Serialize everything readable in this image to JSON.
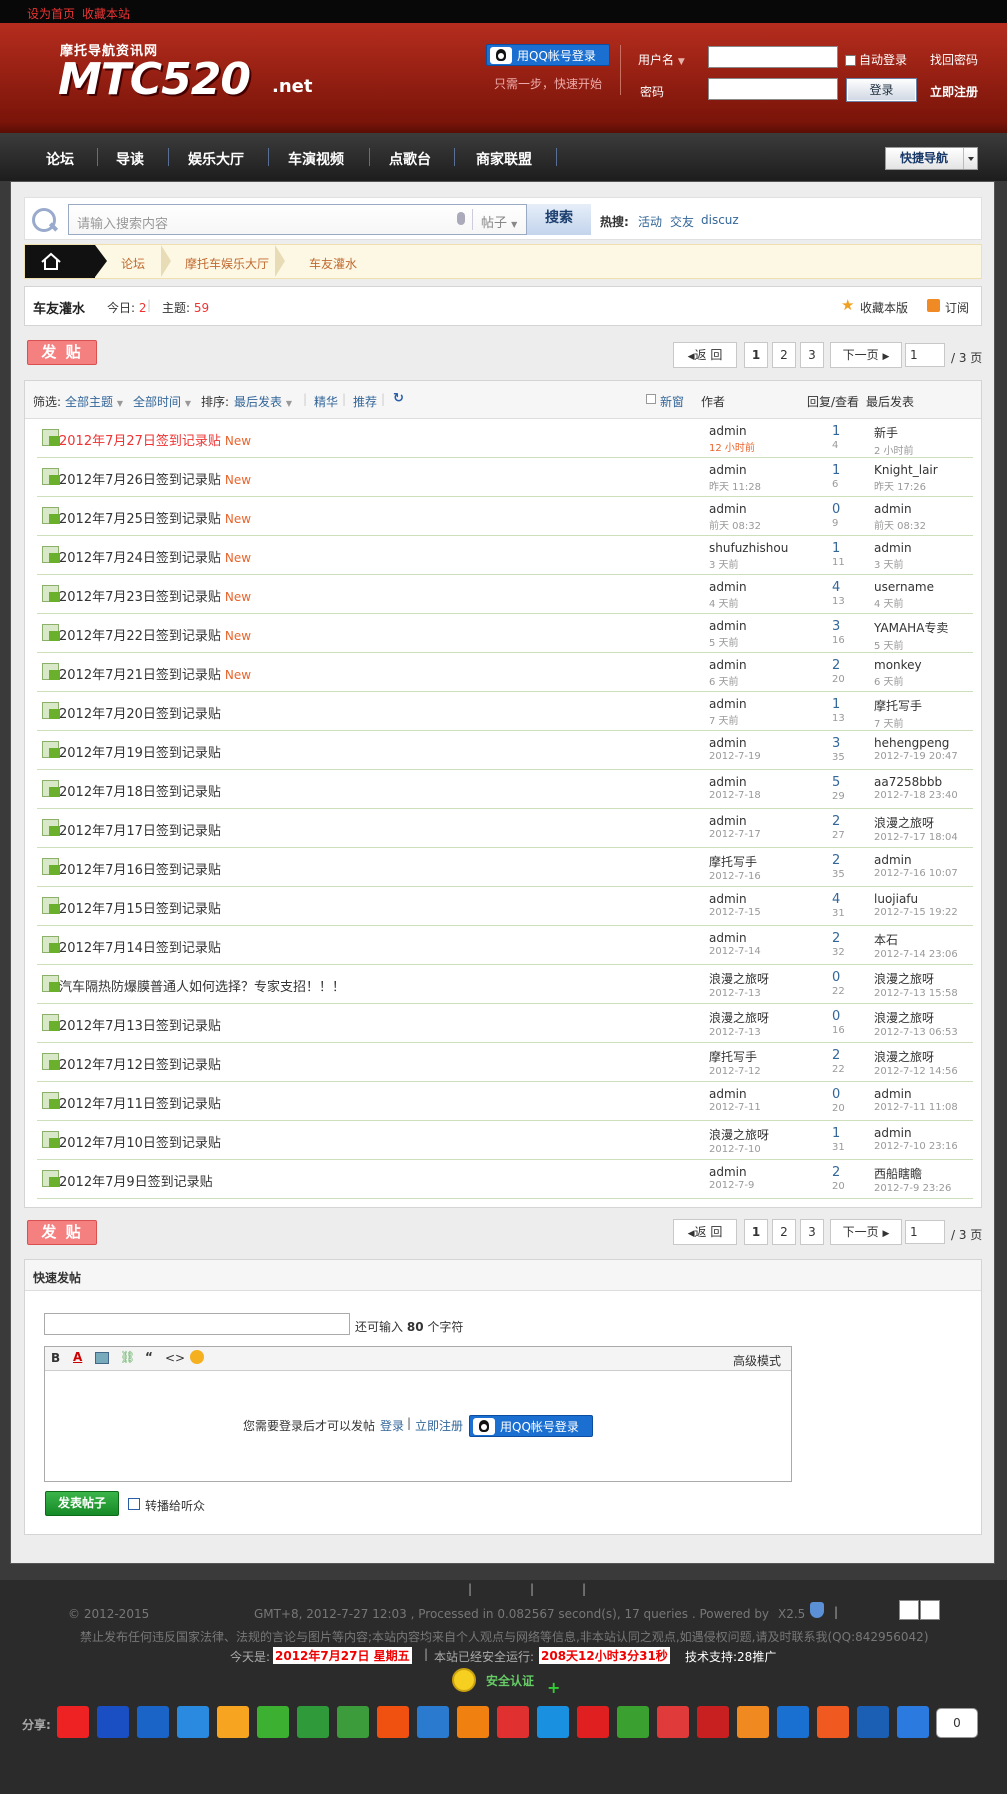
{
  "topbar": {
    "set_home": "设为首页",
    "bookmark": "收藏本站"
  },
  "logo": {
    "top": "摩托导航资讯网",
    "main": "MTC520",
    "suffix": ".net"
  },
  "qq": {
    "login": "用QQ帐号登录",
    "sub": "只需一步，快速开始"
  },
  "login": {
    "username_label": "用户名",
    "password_label": "密码",
    "auto_login": "自动登录",
    "find_password": "找回密码",
    "login_btn": "登录",
    "register": "立即注册"
  },
  "nav": {
    "items": [
      "论坛",
      "导读",
      "娱乐大厅",
      "车演视频",
      "点歌台",
      "商家联盟"
    ],
    "quick": "快捷导航"
  },
  "search": {
    "placeholder": "请输入搜索内容",
    "type": "帖子",
    "button": "搜索",
    "hot_label": "热搜:",
    "hot": [
      "活动",
      "交友",
      "discuz"
    ]
  },
  "breadcrumb": [
    "论坛",
    "摩托车娱乐大厅",
    "车友灌水"
  ],
  "forum": {
    "name": "车友灌水",
    "today_label": "今日:",
    "today": "2",
    "topics_label": "主题:",
    "topics": "59",
    "favorite": "收藏本版",
    "subscribe": "订阅"
  },
  "pager": {
    "post": "发 贴",
    "back": "返 回",
    "pages": [
      "1",
      "2",
      "3"
    ],
    "next": "下一页",
    "input": "1",
    "total": "/ 3 页"
  },
  "filter": {
    "label": "筛选:",
    "all_topics": "全部主题",
    "all_time": "全部时间",
    "sort_label": "排序:",
    "latest": "最后发表",
    "digest": "精华",
    "recommend": "推荐",
    "new_window": "新窗",
    "author": "作者",
    "reply_view": "回复/查看",
    "last_post": "最后发表"
  },
  "threads": [
    {
      "title": "2012年7月27日签到记录贴",
      "new": "New",
      "red": true,
      "author": "admin",
      "date": "12 小时前",
      "replies": "1",
      "views": "4",
      "last": "新手",
      "last_date": "2 小时前"
    },
    {
      "title": "2012年7月26日签到记录贴",
      "new": "New",
      "author": "admin",
      "date": "昨天 11:28",
      "replies": "1",
      "views": "6",
      "last": "Knight_lair",
      "last_date": "昨天 17:26"
    },
    {
      "title": "2012年7月25日签到记录贴",
      "new": "New",
      "author": "admin",
      "date": "前天 08:32",
      "replies": "0",
      "views": "9",
      "last": "admin",
      "last_date": "前天 08:32"
    },
    {
      "title": "2012年7月24日签到记录贴",
      "new": "New",
      "author": "shufuzhishou",
      "date": "3 天前",
      "replies": "1",
      "views": "11",
      "last": "admin",
      "last_date": "3 天前"
    },
    {
      "title": "2012年7月23日签到记录贴",
      "new": "New",
      "author": "admin",
      "date": "4 天前",
      "replies": "4",
      "views": "13",
      "last": "username",
      "last_date": "4 天前"
    },
    {
      "title": "2012年7月22日签到记录贴",
      "new": "New",
      "author": "admin",
      "date": "5 天前",
      "replies": "3",
      "views": "16",
      "last": "YAMAHA专卖",
      "last_date": "5 天前"
    },
    {
      "title": "2012年7月21日签到记录贴",
      "new": "New",
      "author": "admin",
      "date": "6 天前",
      "replies": "2",
      "views": "20",
      "last": "monkey",
      "last_date": "6 天前"
    },
    {
      "title": "2012年7月20日签到记录贴",
      "new": "",
      "author": "admin",
      "date": "7 天前",
      "replies": "1",
      "views": "13",
      "last": "摩托写手",
      "last_date": "7 天前"
    },
    {
      "title": "2012年7月19日签到记录贴",
      "new": "",
      "author": "admin",
      "date": "2012-7-19",
      "replies": "3",
      "views": "35",
      "last": "hehengpeng",
      "last_date": "2012-7-19 20:47"
    },
    {
      "title": "2012年7月18日签到记录贴",
      "new": "",
      "author": "admin",
      "date": "2012-7-18",
      "replies": "5",
      "views": "29",
      "last": "aa7258bbb",
      "last_date": "2012-7-18 23:40"
    },
    {
      "title": "2012年7月17日签到记录贴",
      "new": "",
      "author": "admin",
      "date": "2012-7-17",
      "replies": "2",
      "views": "27",
      "last": "浪漫之旅呀",
      "last_date": "2012-7-17 18:04"
    },
    {
      "title": "2012年7月16日签到记录贴",
      "new": "",
      "author": "摩托写手",
      "date": "2012-7-16",
      "replies": "2",
      "views": "35",
      "last": "admin",
      "last_date": "2012-7-16 10:07"
    },
    {
      "title": "2012年7月15日签到记录贴",
      "new": "",
      "author": "admin",
      "date": "2012-7-15",
      "replies": "4",
      "views": "31",
      "last": "luojiafu",
      "last_date": "2012-7-15 19:22"
    },
    {
      "title": "2012年7月14日签到记录贴",
      "new": "",
      "author": "admin",
      "date": "2012-7-14",
      "replies": "2",
      "views": "32",
      "last": "本石",
      "last_date": "2012-7-14 23:06"
    },
    {
      "title": "汽车隔热防爆膜普通人如何选择？专家支招！！！",
      "new": "",
      "author": "浪漫之旅呀",
      "date": "2012-7-13",
      "replies": "0",
      "views": "22",
      "last": "浪漫之旅呀",
      "last_date": "2012-7-13 15:58"
    },
    {
      "title": "2012年7月13日签到记录贴",
      "new": "",
      "author": "浪漫之旅呀",
      "date": "2012-7-13",
      "replies": "0",
      "views": "16",
      "last": "浪漫之旅呀",
      "last_date": "2012-7-13 06:53"
    },
    {
      "title": "2012年7月12日签到记录贴",
      "new": "",
      "author": "摩托写手",
      "date": "2012-7-12",
      "replies": "2",
      "views": "22",
      "last": "浪漫之旅呀",
      "last_date": "2012-7-12 14:56"
    },
    {
      "title": "2012年7月11日签到记录贴",
      "new": "",
      "author": "admin",
      "date": "2012-7-11",
      "replies": "0",
      "views": "20",
      "last": "admin",
      "last_date": "2012-7-11 11:08"
    },
    {
      "title": "2012年7月10日签到记录贴",
      "new": "",
      "author": "浪漫之旅呀",
      "date": "2012-7-10",
      "replies": "1",
      "views": "31",
      "last": "admin",
      "last_date": "2012-7-10 23:16"
    },
    {
      "title": "2012年7月9日签到记录贴",
      "new": "",
      "author": "admin",
      "date": "2012-7-9",
      "replies": "2",
      "views": "20",
      "last": "西船瞎瞻",
      "last_date": "2012-7-9 23:26"
    }
  ],
  "quickpost": {
    "title": "快速发帖",
    "remain_a": "还可输入",
    "remain_n": "80",
    "remain_b": "个字符",
    "advanced": "高级模式",
    "need_login": "您需要登录后才可以发帖",
    "login": "登录",
    "register": "立即注册",
    "submit": "发表帖子",
    "broadcast": "转播给听众"
  },
  "footer": {
    "copyright": "© 2012-2015",
    "gmt": "GMT+8, 2012-7-27 12:03 , Processed in 0.082567 second(s), 17 queries . Powered by",
    "version": "X2.5",
    "notice": "禁止发布任何违反国家法律、法规的言论与图片等内容;本站内容均来自个人观点与网络等信息,非本站认同之观点,如遇侵权问题,请及时联系我(QQ:842956042)",
    "today_label": "今天是:",
    "today": "2012年7月27日 星期五",
    "running_label": "本站已经安全运行:",
    "running": "208天12小时3分31秒",
    "support": "技术支持:28推广",
    "cert": "安全认证",
    "share_label": "分享:",
    "share_count": "0"
  },
  "colors": {
    "header_red": "#9c2214",
    "accent_red": "#e33",
    "link": "#336699",
    "post_btn": "#f48080"
  }
}
